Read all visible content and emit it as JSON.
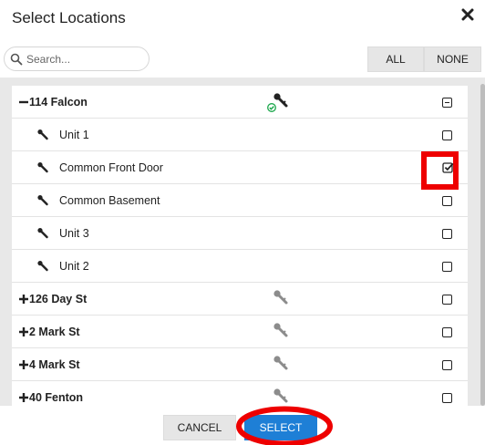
{
  "dialog": {
    "title": "Select Locations",
    "close_icon": "close-x-icon"
  },
  "search": {
    "placeholder": "Search...",
    "value": "",
    "icon": "search-icon"
  },
  "toggles": {
    "all_label": "ALL",
    "none_label": "NONE"
  },
  "locations": [
    {
      "label": "114 Falcon",
      "type": "group",
      "expanded": true,
      "sign": "−",
      "icon": "key-icon",
      "icon_status": "online",
      "checkbox": "indeterminate"
    },
    {
      "label": "Unit 1",
      "type": "child",
      "icon": "key-icon",
      "checkbox": "unchecked"
    },
    {
      "label": "Common Front Door",
      "type": "child",
      "icon": "key-icon",
      "checkbox": "checked",
      "highlighted": true
    },
    {
      "label": "Common Basement",
      "type": "child",
      "icon": "key-icon",
      "checkbox": "unchecked"
    },
    {
      "label": "Unit 3",
      "type": "child",
      "icon": "key-icon",
      "checkbox": "unchecked"
    },
    {
      "label": "Unit 2",
      "type": "child",
      "icon": "key-icon",
      "checkbox": "unchecked"
    },
    {
      "label": "126 Day St",
      "type": "group",
      "expanded": false,
      "sign": "+",
      "icon": "key-icon",
      "checkbox": "unchecked"
    },
    {
      "label": "2 Mark St",
      "type": "group",
      "expanded": false,
      "sign": "+",
      "icon": "key-icon",
      "checkbox": "unchecked"
    },
    {
      "label": "4 Mark St",
      "type": "group",
      "expanded": false,
      "sign": "+",
      "icon": "key-icon",
      "checkbox": "unchecked"
    },
    {
      "label": "40 Fenton",
      "type": "group",
      "expanded": false,
      "sign": "+",
      "icon": "key-icon",
      "checkbox": "unchecked"
    }
  ],
  "footer": {
    "cancel_label": "CANCEL",
    "select_label": "SELECT"
  },
  "colors": {
    "primary_button": "#1e7fd6",
    "highlight": "#ee0000",
    "status_online": "#1aa64a",
    "key_active": "#222222",
    "key_inactive": "#8c8c8c"
  }
}
